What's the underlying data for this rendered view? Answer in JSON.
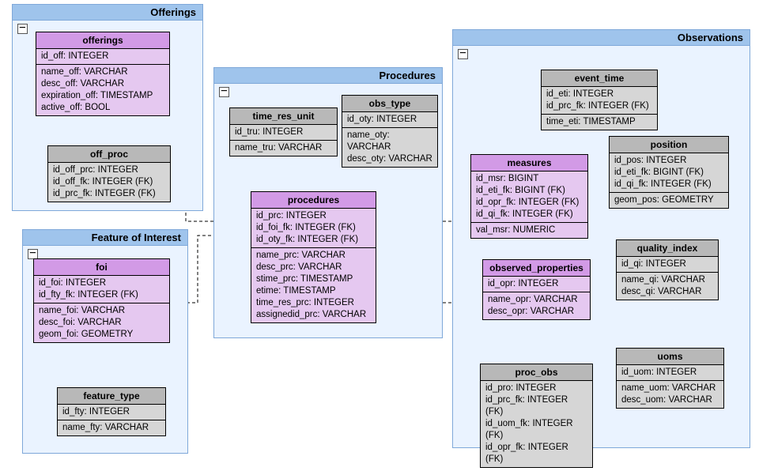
{
  "groups": {
    "offerings": {
      "title": "Offerings"
    },
    "foi_group": {
      "title": "Feature of Interest"
    },
    "procedures": {
      "title": "Procedures"
    },
    "observations": {
      "title": "Observations"
    }
  },
  "tables": {
    "offerings": {
      "name": "offerings",
      "pk": [
        "id_off: INTEGER"
      ],
      "cols": [
        "name_off: VARCHAR",
        "desc_off: VARCHAR",
        "expiration_off: TIMESTAMP",
        "active_off: BOOL"
      ]
    },
    "off_proc": {
      "name": "off_proc",
      "pk": [
        "id_off_prc: INTEGER",
        "id_off_fk: INTEGER (FK)",
        "id_prc_fk: INTEGER (FK)"
      ]
    },
    "foi": {
      "name": "foi",
      "pk": [
        "id_foi: INTEGER",
        "id_fty_fk: INTEGER (FK)"
      ],
      "cols": [
        "name_foi: VARCHAR",
        "desc_foi: VARCHAR",
        "geom_foi: GEOMETRY"
      ]
    },
    "feature_type": {
      "name": "feature_type",
      "pk": [
        "id_fty: INTEGER"
      ],
      "cols": [
        "name_fty: VARCHAR"
      ]
    },
    "time_res_unit": {
      "name": "time_res_unit",
      "pk": [
        "id_tru: INTEGER"
      ],
      "cols": [
        "name_tru: VARCHAR"
      ]
    },
    "obs_type": {
      "name": "obs_type",
      "pk": [
        "id_oty: INTEGER"
      ],
      "cols": [
        "name_oty: VARCHAR",
        "desc_oty: VARCHAR"
      ]
    },
    "procedures": {
      "name": "procedures",
      "pk": [
        "id_prc: INTEGER",
        "id_foi_fk: INTEGER (FK)",
        "id_oty_fk: INTEGER (FK)"
      ],
      "cols": [
        "name_prc: VARCHAR",
        "desc_prc: VARCHAR",
        "stime_prc: TIMESTAMP",
        "etime: TIMESTAMP",
        "time_res_prc: INTEGER",
        "assignedid_prc: VARCHAR"
      ]
    },
    "event_time": {
      "name": "event_time",
      "pk": [
        "id_eti: INTEGER",
        "id_prc_fk: INTEGER (FK)"
      ],
      "cols": [
        "time_eti: TIMESTAMP"
      ]
    },
    "measures": {
      "name": "measures",
      "pk": [
        "id_msr: BIGINT",
        "id_eti_fk: BIGINT (FK)",
        "id_opr_fk: INTEGER (FK)",
        "id_qi_fk: INTEGER (FK)"
      ],
      "cols": [
        "val_msr: NUMERIC"
      ]
    },
    "position": {
      "name": "position",
      "pk": [
        "id_pos: INTEGER",
        "id_eti_fk: BIGINT (FK)",
        "id_qi_fk: INTEGER (FK)"
      ],
      "cols": [
        "geom_pos: GEOMETRY"
      ]
    },
    "observed_properties": {
      "name": "observed_properties",
      "pk": [
        "id_opr: INTEGER"
      ],
      "cols": [
        "name_opr: VARCHAR",
        "desc_opr: VARCHAR"
      ]
    },
    "quality_index": {
      "name": "quality_index",
      "pk": [
        "id_qi: INTEGER"
      ],
      "cols": [
        "name_qi: VARCHAR",
        "desc_qi: VARCHAR"
      ]
    },
    "proc_obs": {
      "name": "proc_obs",
      "pk": [
        "id_pro: INTEGER",
        "id_prc_fk: INTEGER (FK)",
        "id_uom_fk: INTEGER (FK)",
        "id_opr_fk: INTEGER (FK)"
      ]
    },
    "uoms": {
      "name": "uoms",
      "pk": [
        "id_uom: INTEGER"
      ],
      "cols": [
        "name_uom: VARCHAR",
        "desc_uom: VARCHAR"
      ]
    }
  }
}
